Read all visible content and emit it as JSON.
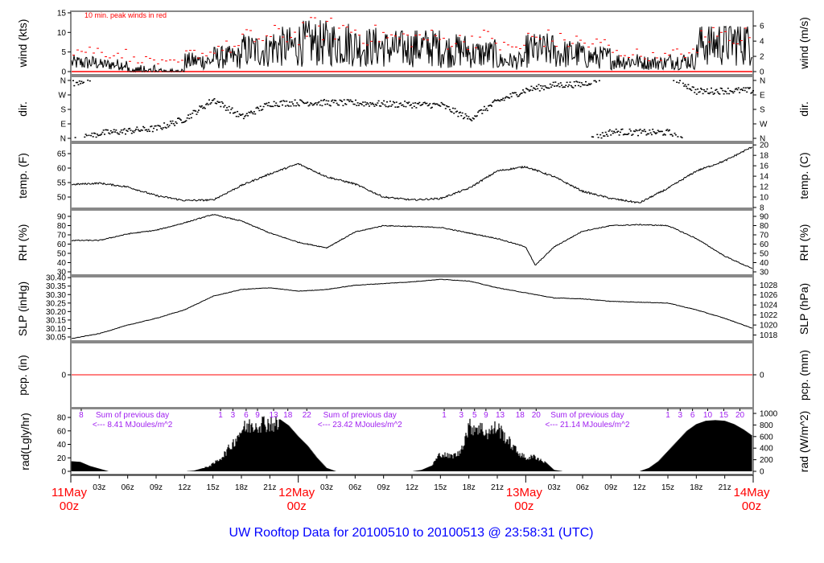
{
  "title": "UW Rooftop Data for 20100510  to  20100513 @ 23:58:31  (UTC)",
  "colors": {
    "line": "#000000",
    "peak": "#ff0000",
    "annotation": "#a020f0",
    "title": "#0000ff",
    "frame": "#888888"
  },
  "chart_data": [
    {
      "type": "line",
      "id": "wind",
      "ylabel": "wind (kts)",
      "ylabel_right": "wind (m/s)",
      "annotation": "10 min. peak winds in red",
      "yticks": [
        0,
        5,
        10,
        15
      ],
      "yticks_right": [
        0,
        2,
        4,
        6
      ],
      "ylim": [
        0,
        15
      ],
      "x_hours_interval_start": [
        0,
        3,
        6,
        9,
        12,
        15,
        18,
        21,
        24,
        27,
        30,
        33,
        36,
        39,
        42,
        45,
        48,
        51,
        54,
        57,
        60,
        63,
        66,
        69
      ],
      "mean_kts": [
        2.5,
        2,
        1,
        0.5,
        3,
        4,
        6,
        7,
        8,
        8,
        7,
        6.5,
        7,
        6,
        5,
        3,
        6,
        5,
        4,
        3,
        2.5,
        3,
        8,
        8.5
      ],
      "peak_kts": [
        7,
        6,
        4,
        3,
        6,
        8,
        11,
        12,
        14,
        14,
        12,
        11,
        11,
        10,
        11,
        8,
        11,
        10,
        9,
        6,
        5,
        6,
        12,
        12
      ]
    },
    {
      "type": "scatter",
      "id": "dir",
      "ylabel": "dir.",
      "ylabel_right": "dir.",
      "yticks": [
        "N",
        "E",
        "S",
        "W",
        "N"
      ],
      "ylim_deg": [
        0,
        360
      ],
      "x_hours": [
        0,
        3,
        6,
        9,
        12,
        15,
        18,
        21,
        24,
        27,
        30,
        33,
        36,
        39,
        42,
        45,
        48,
        51,
        54,
        57,
        60,
        63,
        66,
        69,
        72
      ],
      "deg": [
        -20,
        30,
        45,
        60,
        120,
        240,
        130,
        215,
        220,
        220,
        218,
        212,
        208,
        205,
        120,
        230,
        300,
        330,
        335,
        400,
        395,
        395,
        290,
        295,
        295
      ]
    },
    {
      "type": "line",
      "id": "temp",
      "ylabel": "temp. (F)",
      "ylabel_right": "temp. (C)",
      "yticks": [
        50,
        55,
        60,
        65
      ],
      "yticks_right": [
        8,
        10,
        12,
        14,
        16,
        18,
        20
      ],
      "x_hours": [
        0,
        3,
        6,
        9,
        12,
        15,
        18,
        21,
        24,
        27,
        30,
        33,
        36,
        39,
        42,
        45,
        48,
        51,
        54,
        57,
        60,
        63,
        66,
        69,
        72
      ],
      "values": [
        54.3,
        54.8,
        53.5,
        50.5,
        48.8,
        49,
        54,
        58,
        61.5,
        57,
        54.5,
        50,
        49,
        49.5,
        53,
        59,
        60.5,
        57,
        52,
        49.5,
        48,
        53,
        59,
        62.5,
        67.5
      ]
    },
    {
      "type": "line",
      "id": "rh",
      "ylabel": "RH (%)",
      "ylabel_right": "RH (%)",
      "yticks": [
        30,
        40,
        50,
        60,
        70,
        80,
        90
      ],
      "yticks_right": [
        30,
        40,
        50,
        60,
        70,
        80,
        90
      ],
      "x_hours": [
        0,
        3,
        6,
        9,
        12,
        15,
        18,
        21,
        24,
        27,
        30,
        33,
        36,
        39,
        42,
        45,
        48,
        49,
        51,
        54,
        57,
        60,
        63,
        66,
        69,
        72
      ],
      "values": [
        64,
        64,
        71,
        75,
        83,
        92,
        85,
        72,
        62,
        56,
        73,
        80,
        79,
        78,
        72,
        66,
        57,
        37,
        57,
        74,
        80,
        81,
        80,
        66,
        47,
        33
      ]
    },
    {
      "type": "line",
      "id": "slp",
      "ylabel": "SLP (inHg)",
      "ylabel_right": "SLP (hPa)",
      "yticks": [
        30.05,
        30.1,
        30.15,
        30.2,
        30.25,
        30.3,
        30.35,
        30.4
      ],
      "yticks_right": [
        1018,
        1020,
        1022,
        1024,
        1026,
        1028
      ],
      "x_hours": [
        0,
        3,
        6,
        9,
        12,
        15,
        18,
        21,
        24,
        27,
        30,
        33,
        36,
        39,
        42,
        45,
        48,
        51,
        54,
        57,
        60,
        63,
        66,
        69,
        72
      ],
      "values": [
        30.04,
        30.07,
        30.12,
        30.16,
        30.21,
        30.29,
        30.33,
        30.34,
        30.32,
        30.33,
        30.355,
        30.365,
        30.375,
        30.39,
        30.38,
        30.34,
        30.31,
        30.28,
        30.275,
        30.26,
        30.255,
        30.25,
        30.21,
        30.16,
        30.1
      ]
    },
    {
      "type": "line",
      "id": "pcp",
      "ylabel": "pcp. (in)",
      "ylabel_right": "pcp. (mm)",
      "yticks": [
        0
      ],
      "yticks_right": [
        0
      ],
      "value": 0
    },
    {
      "type": "area",
      "id": "rad",
      "ylabel": "rad(Lgly/hr)",
      "ylabel_right": "rad (W/m^2)",
      "yticks": [
        0,
        20,
        40,
        60,
        80
      ],
      "yticks_right": [
        0,
        200,
        400,
        600,
        800,
        1000
      ],
      "x_hours_step": 1,
      "values": [
        15,
        14,
        8,
        4,
        0,
        0,
        0,
        0,
        0,
        0,
        0,
        0,
        0,
        1,
        5,
        12,
        25,
        45,
        70,
        78,
        82,
        82,
        78,
        68,
        52,
        38,
        20,
        5,
        0,
        0,
        0,
        0,
        0,
        0,
        0,
        0,
        0,
        2,
        8,
        30,
        25,
        30,
        75,
        75,
        65,
        75,
        55,
        35,
        22,
        25,
        15,
        2,
        0,
        0,
        0,
        0,
        0,
        0,
        0,
        0,
        0,
        5,
        15,
        30,
        45,
        60,
        70,
        75,
        76,
        75,
        70,
        62,
        52
      ],
      "cumulative_markers": [
        {
          "hour": 1.1,
          "label": "8"
        },
        {
          "hour": 15.8,
          "label": "1"
        },
        {
          "hour": 17.1,
          "label": "3"
        },
        {
          "hour": 18.5,
          "label": "6"
        },
        {
          "hour": 19.7,
          "label": "9"
        },
        {
          "hour": 21.4,
          "label": "13"
        },
        {
          "hour": 22.9,
          "label": "18"
        },
        {
          "hour": 24.9,
          "label": "22"
        },
        {
          "hour": 39.4,
          "label": "1"
        },
        {
          "hour": 41.2,
          "label": "3"
        },
        {
          "hour": 42.6,
          "label": "5"
        },
        {
          "hour": 43.8,
          "label": "9"
        },
        {
          "hour": 45.3,
          "label": "13"
        },
        {
          "hour": 47.4,
          "label": "18"
        },
        {
          "hour": 49.1,
          "label": "20"
        },
        {
          "hour": 63.0,
          "label": "1"
        },
        {
          "hour": 64.3,
          "label": "3"
        },
        {
          "hour": 65.6,
          "label": "6"
        },
        {
          "hour": 67.2,
          "label": "10"
        },
        {
          "hour": 68.9,
          "label": "15"
        },
        {
          "hour": 70.6,
          "label": "20"
        }
      ],
      "daily_sums": [
        {
          "hour": 6.5,
          "heading": "Sum of previous day",
          "value": "<--- 8.41 MJoules/m^2"
        },
        {
          "hour": 30.5,
          "heading": "Sum of previous day",
          "value": "<--- 23.42 MJoules/m^2"
        },
        {
          "hour": 54.5,
          "heading": "Sum of previous day",
          "value": "<--- 21.14 MJoules/m^2"
        }
      ]
    }
  ],
  "x_axis": {
    "hour_labels": [
      {
        "hour": 3,
        "label": "03z"
      },
      {
        "hour": 6,
        "label": "06z"
      },
      {
        "hour": 9,
        "label": "09z"
      },
      {
        "hour": 12,
        "label": "12z"
      },
      {
        "hour": 15,
        "label": "15z"
      },
      {
        "hour": 18,
        "label": "18z"
      },
      {
        "hour": 21,
        "label": "21z"
      },
      {
        "hour": 27,
        "label": "03z"
      },
      {
        "hour": 30,
        "label": "06z"
      },
      {
        "hour": 33,
        "label": "09z"
      },
      {
        "hour": 36,
        "label": "12z"
      },
      {
        "hour": 39,
        "label": "15z"
      },
      {
        "hour": 42,
        "label": "18z"
      },
      {
        "hour": 45,
        "label": "21z"
      },
      {
        "hour": 51,
        "label": "03z"
      },
      {
        "hour": 54,
        "label": "06z"
      },
      {
        "hour": 57,
        "label": "09z"
      },
      {
        "hour": 60,
        "label": "12z"
      },
      {
        "hour": 63,
        "label": "15z"
      },
      {
        "hour": 66,
        "label": "18z"
      },
      {
        "hour": 69,
        "label": "21z"
      }
    ],
    "day_labels": [
      {
        "hour": 0,
        "date": "11May",
        "time": "00z"
      },
      {
        "hour": 24,
        "date": "12May",
        "time": "00z"
      },
      {
        "hour": 48,
        "date": "13May",
        "time": "00z"
      },
      {
        "hour": 72,
        "date": "14May",
        "time": "00z"
      }
    ]
  }
}
